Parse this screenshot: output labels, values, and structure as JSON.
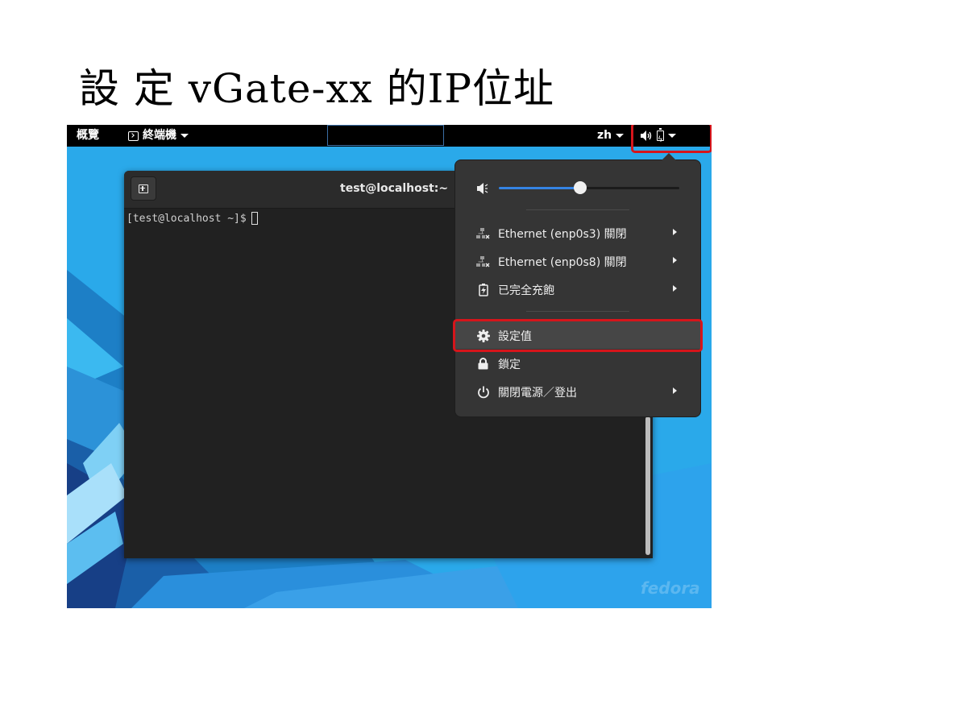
{
  "slide": {
    "title": "設 定 vGate-xx 的IP位址"
  },
  "topbar": {
    "activities": "概覽",
    "app_menu": "終端機",
    "language": "zh"
  },
  "terminal": {
    "title": "test@localhost:~",
    "prompt": "[test@localhost ~]$"
  },
  "system_menu": {
    "volume_level": 0.45,
    "items": [
      {
        "icon": "network-disconnected-icon",
        "label": "Ethernet (enp0s3) 關閉",
        "submenu": true
      },
      {
        "icon": "network-disconnected-icon",
        "label": "Ethernet (enp0s8) 關閉",
        "submenu": true
      },
      {
        "icon": "battery-charging-icon",
        "label": "已完全充飽",
        "submenu": true
      },
      {
        "icon": "gear-icon",
        "label": "設定值",
        "submenu": false
      },
      {
        "icon": "lock-icon",
        "label": "鎖定",
        "submenu": false
      },
      {
        "icon": "power-icon",
        "label": "關閉電源／登出",
        "submenu": true
      }
    ]
  },
  "watermark": "fedora",
  "colors": {
    "accent": "#3584e4",
    "annotation_red": "#d6151b",
    "menu_bg": "#353535",
    "terminal_bg": "#212121",
    "wallpaper_blue": "#29a8ea"
  }
}
